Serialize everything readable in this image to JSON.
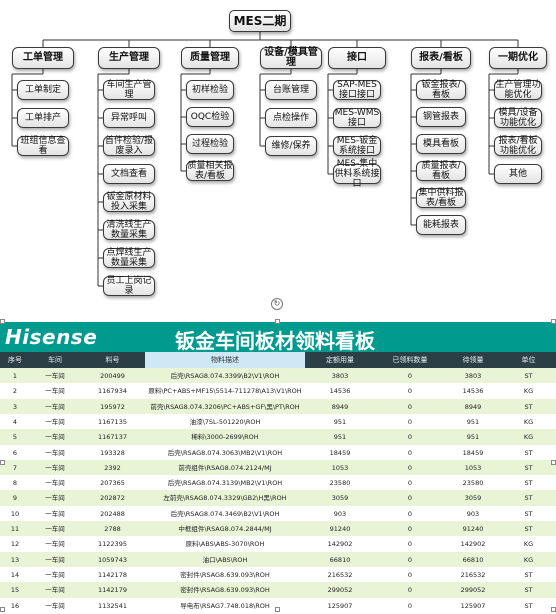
{
  "diagram": {
    "root": "MES二期",
    "categories": [
      {
        "label": "工单管理",
        "items": [
          "工单制定",
          "工单排产",
          "班组信息查看"
        ]
      },
      {
        "label": "生产管理",
        "items": [
          "车间生产管理",
          "异常呼叫",
          "首件检验/报废录入",
          "文档查看",
          "钣金原材料投入采集",
          "清洗线生产数量采集",
          "点焊线生产数量采集",
          "员工上岗记录"
        ]
      },
      {
        "label": "质量管理",
        "items": [
          "初样检验",
          "OQC检验",
          "过程检验",
          "质量相关报表/看板"
        ]
      },
      {
        "label": "设备/模具管理",
        "items": [
          "台账管理",
          "点检操作",
          "维修/保养"
        ]
      },
      {
        "label": "接口",
        "items": [
          "SAP-MES接口接口",
          "MES-WMS接口",
          "MES-钣金系统接口",
          "MES-集中供料系统接口"
        ]
      },
      {
        "label": "报表/看板",
        "items": [
          "钣金报表/看板",
          "钢管报表",
          "模具看板",
          "质量报表/看板",
          "集中供料报表/看板",
          "能耗报表"
        ]
      },
      {
        "label": "一期优化",
        "items": [
          "生产管理功能优化",
          "模具/设备功能优化",
          "报表/看板功能优化",
          "其他"
        ]
      }
    ]
  },
  "board": {
    "logo": "Hisense",
    "title": "钣金车间板材领料看板",
    "columns": [
      "序号",
      "车间",
      "料号",
      "物料描述",
      "定额用量",
      "已领料数量",
      "待领量",
      "单位"
    ],
    "rows": [
      [
        "1",
        "一车间",
        "200499",
        "后壳\\RSAG8.074.3399\\B2\\V1\\ROH",
        "3803",
        "0",
        "3803",
        "ST"
      ],
      [
        "2",
        "一车间",
        "1167934",
        "原料\\PC+ABS+MF15\\5514-711278\\A13\\V1\\ROH",
        "14536",
        "0",
        "14536",
        "KG"
      ],
      [
        "3",
        "一车间",
        "195972",
        "前壳\\RSAG8.074.3206\\PC+ABS+GF\\黑\\PT\\ROH",
        "8949",
        "0",
        "8949",
        "ST"
      ],
      [
        "4",
        "一车间",
        "1167135",
        "油漆\\7SL-501220\\ROH",
        "951",
        "0",
        "951",
        "KG"
      ],
      [
        "5",
        "一车间",
        "1167137",
        "稀料\\3000-2699\\ROH",
        "951",
        "0",
        "951",
        "KG"
      ],
      [
        "6",
        "一车间",
        "193328",
        "后壳\\RSAG8.074.3063\\MB2\\V1\\ROH",
        "18459",
        "0",
        "18459",
        "ST"
      ],
      [
        "7",
        "一车间",
        "2392",
        "前壳组件\\RSAG8.074.2124/MJ",
        "1053",
        "0",
        "1053",
        "ST"
      ],
      [
        "8",
        "一车间",
        "207365",
        "后壳\\RSAG8.074.3139\\MB2\\V1\\ROH",
        "23580",
        "0",
        "23580",
        "ST"
      ],
      [
        "9",
        "一车间",
        "202872",
        "左前壳\\RSAG8.074.3329\\GB2\\H黑\\ROH",
        "3059",
        "0",
        "3059",
        "ST"
      ],
      [
        "10",
        "一车间",
        "202488",
        "后壳\\RSAG8.074.3469\\B2\\V1\\ROH",
        "903",
        "0",
        "903",
        "ST"
      ],
      [
        "11",
        "一车间",
        "2788",
        "中框组件\\RSAG8.074.2844/MJ",
        "91240",
        "0",
        "91240",
        "ST"
      ],
      [
        "12",
        "一车间",
        "1122395",
        "原料\\ABS\\ABS-3070\\ROH",
        "142902",
        "0",
        "142902",
        "KG"
      ],
      [
        "13",
        "一车间",
        "1059743",
        "油口\\ABS\\ROH",
        "66810",
        "0",
        "66810",
        "KG"
      ],
      [
        "14",
        "一车间",
        "1142178",
        "密封件\\RSAG8.639.093\\ROH",
        "216532",
        "0",
        "216532",
        "ST"
      ],
      [
        "15",
        "一车间",
        "1142179",
        "密封件\\RSAG8.639.093\\ROH",
        "299052",
        "0",
        "299052",
        "ST"
      ],
      [
        "16",
        "一车间",
        "1132541",
        "导电布\\RSAG7.748.018\\ROH",
        "125907",
        "0",
        "125907",
        "ST"
      ]
    ]
  },
  "colors": {
    "board_title_bg": "#009b8e",
    "header_bg": "#2b3f47",
    "row_alt": "#e9f3d6"
  }
}
